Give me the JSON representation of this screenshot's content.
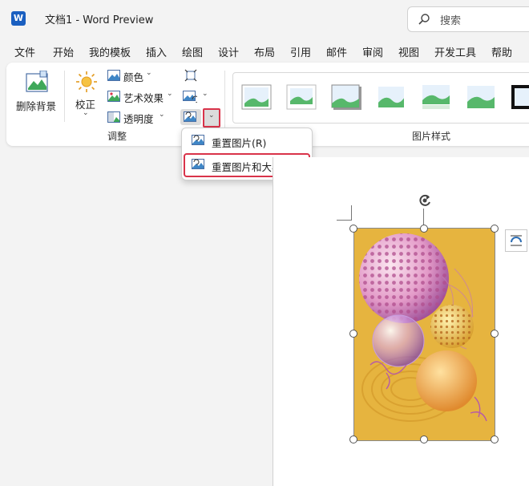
{
  "titlebar": {
    "logo": "W",
    "title": "文档1  -  Word Preview",
    "search_placeholder": "搜索"
  },
  "tabs": [
    "文件",
    "开始",
    "我的模板",
    "插入",
    "绘图",
    "设计",
    "布局",
    "引用",
    "邮件",
    "审阅",
    "视图",
    "开发工具",
    "帮助"
  ],
  "ribbon": {
    "remove_bg": "删除背景",
    "corrections": "校正",
    "color": "颜色",
    "artistic": "艺术效果",
    "transparency": "透明度",
    "adjust_group": "调整",
    "styles_group": "图片样式"
  },
  "dropdown": {
    "item1": "重置图片(R)",
    "item2": "重置图片和大小(S)"
  },
  "colors": {
    "accent_red": "#d9334a",
    "word_blue": "#1a5fc0"
  }
}
